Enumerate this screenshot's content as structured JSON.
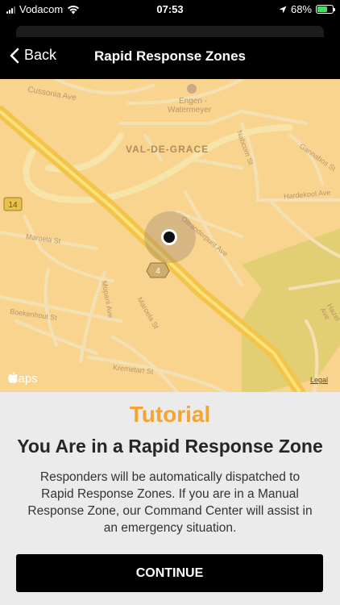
{
  "status_bar": {
    "carrier": "Vodacom",
    "time": "07:53",
    "battery_percent": "68%",
    "battery_level": 0.68,
    "icons": [
      "signal-icon",
      "wifi-icon",
      "location-arrow-icon",
      "battery-charging-icon"
    ]
  },
  "nav": {
    "back_label": "Back",
    "title": "Rapid Response Zones"
  },
  "map": {
    "area_label": "VAL-DE-GRACE",
    "streets": {
      "cussonia": "Cussonia Ave",
      "engen": "Engen -",
      "watermeyer": "Watermeyer",
      "nabcom": "Nabcom St",
      "gannabos": "Gannabos St",
      "hardekool": "Hardekool Ave",
      "oleander": "Oleanderpunt Ave",
      "maroela_left": "Maroela St",
      "maroela_mid": "Maroela St",
      "boekenhout": "Boekenhout St",
      "mopani": "Mopani Ave",
      "krometart": "Kremetart St",
      "hazel": "Hazel Ave"
    },
    "route_shields": [
      "14",
      "4"
    ],
    "attribution": "Maps",
    "legal_label": "Legal",
    "colors": {
      "land": "#f9d48f",
      "highway": "#f5c74a",
      "park": "#e0ce71"
    }
  },
  "tutorial": {
    "label": "Tutorial",
    "heading": "You Are in a Rapid Response Zone",
    "body": "Responders will be automatically dispatched to Rapid Response Zones. If you are in a Manual Response Zone, our Command Center will assist in an emergency situation.",
    "button_label": "CONTINUE",
    "accent_color": "#f5a431"
  }
}
